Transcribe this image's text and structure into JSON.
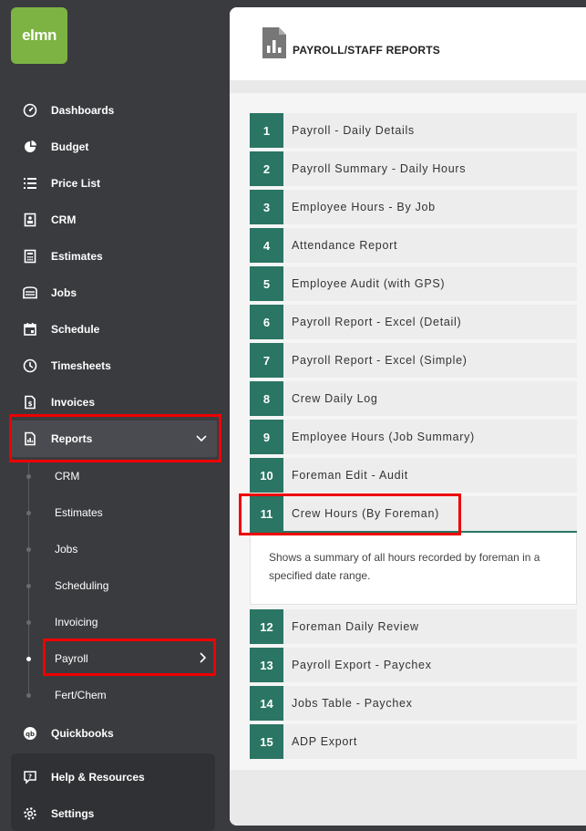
{
  "logo_text": "elmn",
  "nav": [
    {
      "label": "Dashboards",
      "icon": "dashboard-gauge-icon"
    },
    {
      "label": "Budget",
      "icon": "pie-chart-icon"
    },
    {
      "label": "Price List",
      "icon": "list-icon"
    },
    {
      "label": "CRM",
      "icon": "contact-card-icon"
    },
    {
      "label": "Estimates",
      "icon": "calculator-icon"
    },
    {
      "label": "Jobs",
      "icon": "truck-icon"
    },
    {
      "label": "Schedule",
      "icon": "calendar-icon"
    },
    {
      "label": "Timesheets",
      "icon": "clock-icon"
    },
    {
      "label": "Invoices",
      "icon": "invoice-icon"
    },
    {
      "label": "Reports",
      "icon": "report-icon"
    }
  ],
  "reports_sub": [
    "CRM",
    "Estimates",
    "Jobs",
    "Scheduling",
    "Invoicing",
    "Payroll",
    "Fert/Chem"
  ],
  "quickbooks_label": "Quickbooks",
  "help_label": "Help & Resources",
  "settings_label": "Settings",
  "page_title": "PAYROLL/STAFF REPORTS",
  "reports": [
    {
      "num": "1",
      "name": "Payroll - Daily Details"
    },
    {
      "num": "2",
      "name": "Payroll Summary - Daily Hours"
    },
    {
      "num": "3",
      "name": "Employee Hours - By Job"
    },
    {
      "num": "4",
      "name": "Attendance Report"
    },
    {
      "num": "5",
      "name": "Employee Audit (with GPS)"
    },
    {
      "num": "6",
      "name": "Payroll Report - Excel (Detail)"
    },
    {
      "num": "7",
      "name": "Payroll Report - Excel (Simple)"
    },
    {
      "num": "8",
      "name": "Crew Daily Log"
    },
    {
      "num": "9",
      "name": "Employee Hours (Job Summary)"
    },
    {
      "num": "10",
      "name": "Foreman Edit - Audit"
    },
    {
      "num": "11",
      "name": "Crew Hours (By Foreman)"
    },
    {
      "num": "12",
      "name": "Foreman Daily Review"
    },
    {
      "num": "13",
      "name": "Payroll Export - Paychex"
    },
    {
      "num": "14",
      "name": "Jobs Table - Paychex"
    },
    {
      "num": "15",
      "name": "ADP Export"
    }
  ],
  "expanded_description": "Shows a summary of all hours recorded by foreman in a specified date range.",
  "colors": {
    "accent": "#2a7563",
    "logo": "#7cb342",
    "highlight": "#e00000",
    "sidebar": "#3a3b3f"
  }
}
